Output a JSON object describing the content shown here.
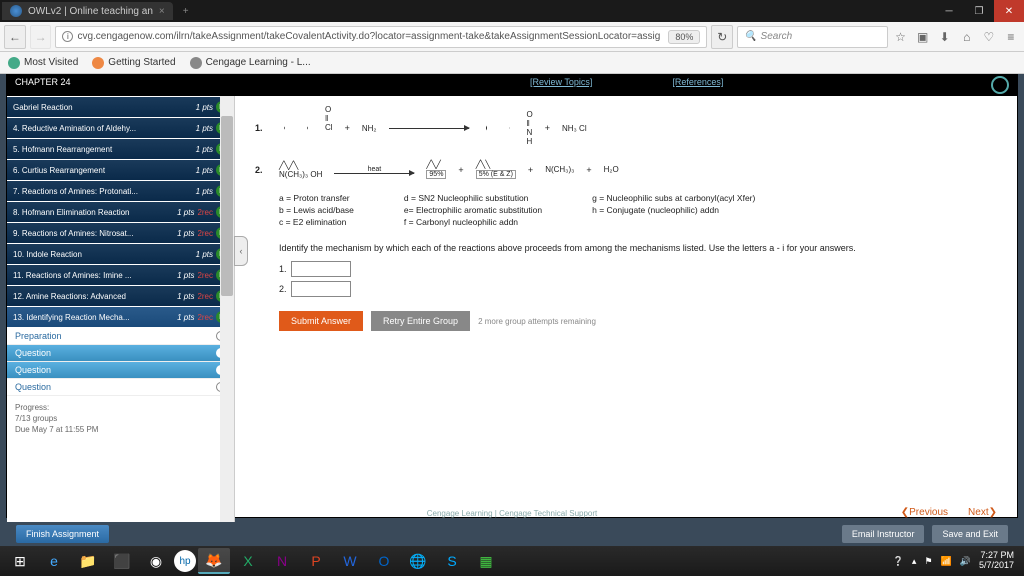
{
  "browser": {
    "tab_title": "OWLv2 | Online teaching an",
    "url": "cvg.cengagenow.com/ilrn/takeAssignment/takeCovalentActivity.do?locator=assignment-take&takeAssignmentSessionLocator=assig",
    "zoom": "80%",
    "search_placeholder": "Search"
  },
  "bookmarks": {
    "most_visited": "Most Visited",
    "getting_started": "Getting Started",
    "cengage": "Cengage Learning - L..."
  },
  "header": {
    "chapter": "CHAPTER 24",
    "review": "[Review Topics]",
    "references": "[References]"
  },
  "sidebar": {
    "items": [
      {
        "label": "Gabriel Reaction",
        "pts": "1 pts"
      },
      {
        "label": "4. Reductive Amination of Aldehy...",
        "pts": "1 pts"
      },
      {
        "label": "5. Hofmann Rearrangement",
        "pts": "1 pts"
      },
      {
        "label": "6. Curtius Rearrangement",
        "pts": "1 pts"
      },
      {
        "label": "7. Reactions of Amines: Protonati...",
        "pts": "1 pts"
      },
      {
        "label": "8. Hofmann Elimination Reaction",
        "pts": "1 pts",
        "extra": "2rec"
      },
      {
        "label": "9. Reactions of Amines: Nitrosat...",
        "pts": "1 pts",
        "extra": "2rec"
      },
      {
        "label": "10. Indole Reaction",
        "pts": "1 pts"
      },
      {
        "label": "11. Reactions of Amines: Imine ...",
        "pts": "1 pts",
        "extra": "2rec"
      },
      {
        "label": "12. Amine Reactions: Advanced",
        "pts": "1 pts",
        "extra": "2rec"
      },
      {
        "label": "13. Identifying Reaction Mecha...",
        "pts": "1 pts",
        "extra": "2rec"
      }
    ],
    "subs": [
      {
        "label": "Preparation"
      },
      {
        "label": "Question",
        "sel": true
      },
      {
        "label": "Question",
        "sel": true
      },
      {
        "label": "Question"
      }
    ],
    "progress": {
      "title": "Progress:",
      "groups": "7/13 groups",
      "due": "Due May 7 at 11:55 PM"
    }
  },
  "reactions": {
    "r1_num": "1.",
    "r1_labels": {
      "nh2": "NH₂",
      "nh3cl": "NH₃   Cl"
    },
    "r2_num": "2.",
    "r2_labels": {
      "reagent": "N(CH₃)₃  OH",
      "heat": "heat",
      "pct95": "95%",
      "pct5": "5% (E & Z)",
      "plus_n": "N(CH₃)₃",
      "plus_h2o": "H₂O"
    }
  },
  "legend": {
    "a": "a = Proton transfer",
    "b": "b = Lewis acid/base",
    "c": "c = E2 elimination",
    "d": "d = SN2 Nucleophilic substitution",
    "e": "e= Electrophilic aromatic substitution",
    "f": "f = Carbonyl nucleophilic addn",
    "g": "g = Nucleophilic subs at carbonyl(acyl Xfer)",
    "h": "h = Conjugate (nucleophilic) addn"
  },
  "question": {
    "instruction": "Identify the mechanism by which each of the reactions above proceeds from among the mechanisms listed. Use the letters a - i for your answers.",
    "a1_label": "1.",
    "a2_label": "2.",
    "submit": "Submit Answer",
    "retry": "Retry Entire Group",
    "attempts": "2 more group attempts remaining"
  },
  "nav": {
    "prev": "Previous",
    "next": "Next"
  },
  "footer": {
    "finish": "Finish Assignment",
    "email": "Email Instructor",
    "save": "Save and Exit",
    "credit": "Cengage Learning  |  Cengage Technical Support"
  },
  "tray": {
    "time": "7:27 PM",
    "date": "5/7/2017"
  }
}
